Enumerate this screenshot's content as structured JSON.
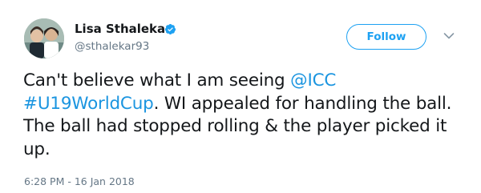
{
  "user": {
    "name": "Lisa Sthalekar",
    "handle": "@sthalekar93",
    "verified": true
  },
  "follow_button": {
    "label": "Follow"
  },
  "tweet": {
    "text_part1": "Can't believe what I am seeing ",
    "mention": "@ICC",
    "hashtag": "#U19WorldCup",
    "text_part2": ". WI appealed for handling the ball. The ball had stopped rolling & the player picked it up.",
    "timestamp": "6:28 PM - 16 Jan 2018"
  },
  "colors": {
    "accent": "#1da1f2",
    "link": "#1b95e0",
    "muted": "#657786",
    "text": "#14171a"
  },
  "icons": {
    "verified": "verified-badge-icon",
    "menu": "chevron-down-icon"
  }
}
